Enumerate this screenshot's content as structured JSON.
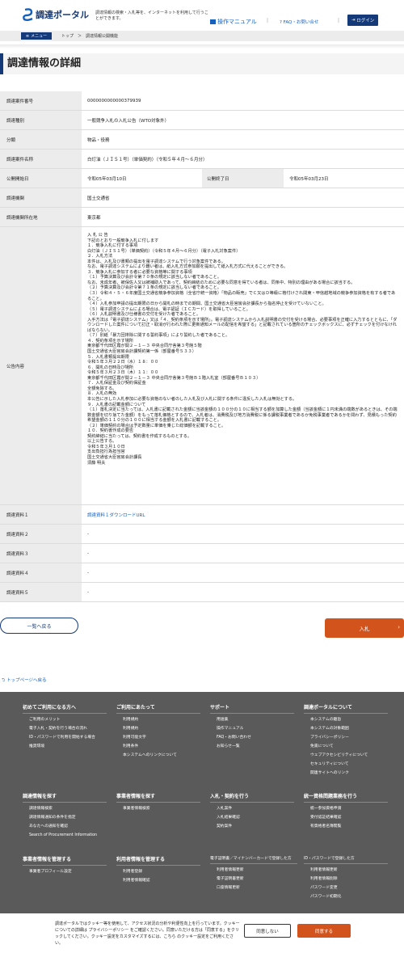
{
  "header": {
    "logo_text": "調達ポータル",
    "tagline": "調達情報の検索・入札等を、インターネットを利用して行うことができます。",
    "manual": "操作マニュアル",
    "faq": "FAQ・お問い合せ",
    "login": "ログイン"
  },
  "crumbbar": {
    "menu": "メニュー",
    "crumbs": "トップ　＞　調達情報公開機能"
  },
  "page_title": "調達情報の詳細",
  "detail": {
    "case_no_label": "調達案件番号",
    "case_no": "0000000000000379939",
    "type_label": "調達種別",
    "type": "一般競争入札の入札公告（WTO対象外）",
    "category_label": "分類",
    "category": "物品・役務",
    "name_label": "調達案件名称",
    "name": "白灯油（ＪＩＳ１号）（単価契約）（令和５年４月～６月分）",
    "start_label": "公開開始日",
    "start": "令和05年03月10日",
    "end_label": "公開終了日",
    "end": "令和05年03月23日",
    "org_label": "調達機関",
    "org": "国土交通省",
    "loc_label": "調達機関所在地",
    "loc": "東京都",
    "notice_label": "公告内容",
    "notice": "入 札 公 告\n下記のとおり一般競争入札に付します\n１．競争入札に付する事項\n白灯油（ＪＩＳ１号）（単価契約）（令和５年４月～６月分）（電子入札対象案件）\n２．入札方法\n本件は、入札及び書類の提出を電子調達システムで行う対象案件である。\nなお、電子調達システムにより難い者は、紙入札方式参加願を提出して紙入札方式に代えることができる。\n３．競争入札に参加する者に必要な資格等に関する事項\n（１）予算決算及び会計令第７０条の規定に該当しない者であること。\nなお、未成年者、被保佐人又は被補助人であって、契約締結のために必要な同意を得ている者は、同条中、特別の理由がある場合に該当する。\n（２）予算決算及び会計令第７１条の規定に該当しない者であること。\n（３）令和４・５・６年度国土交通省競争参加資格（全省庁統一資格）「物品の販売」でＣ又はＤ等級に格付けされ関東・甲信越地域の競争参加資格を有する者であること。\n（４）入札参加申請の提出期限の日から開札の時までの期間、国土交通省大臣官房会計課長から指名停止を受けていないこと。\n（５）電子調達システムによる場合は、電子認証（ＩＣカード）を取得していること。\n（６）入札説明書及び仕様書の交付を受けた者であること。\n入手方法は「電子調達システム」又は「４．契約条項を示す場所」。電子調達システムから入札説明書の交付を受ける場合、必要事項を正確に入力するとともに、「ダウンロードした案件について訂正・取消が行われた際に更新通知メールの配信を希望する」と記載されている箇所のチェックボックスに、必ずチェックを付けなければならない。\n（７）別紙「暴力団排除に関する誓約事項」により誓約した者であること。\n４．契約条項を示す場所\n東京都千代田区霞が関２－１－３ 中央合同庁舎第３号館５階\n国土交通省大臣官房会計課契約第一係（部屋番号５３３）\n５．入札書類提出期限\n令和５年３月２２日（水）１８：００\n６．開札の日時及び場所\n令和５年３月２３日（木）１１：００\n東京都千代田区霞が関２－１－３ 中央合同庁舎第３号館Ｂ１階入札室（部屋番号Ｂ１０３）\n７．入札保証金及び契約保証金\n全額免除する。\n８．入札の無効\n本公告に示した入札参加に必要な資格のない者のした入札及び入札に関する条件に違反した入札は無効とする。\n９．入札書の記載金額について\n（１）落札決定に当たっては、入札書に記載された金額に当該金額の１００分の１０に相当する額を加算した金額（当該金額に１円未満の端数があるときは、その端数金額を切り捨てた金額）をもって落札価格とするので、入札者は、消費税及び地方消費税に係る課税事業者であるか免税事業者であるかを問わず、見積もった契約希望金額の１１０分の１００に相当する金額を入札書に記載すること。\n（２）単価契約の場合は予定数量に単価を乗じた総価額を記載すること。\n１０．契約書作成の要否\n契約締結に当たっては、契約書を作成するものとする。\n以上公告する。\n令和５年３月１０日\n支出負担行為担当官\n国土交通省大臣官房会計課長\n須藤 明夫",
    "doc1_label": "調達資料１",
    "doc1": "調達資料１ダウンロードURL",
    "doc2_label": "調達資料２",
    "doc2": "-",
    "doc3_label": "調達資料３",
    "doc3": "-",
    "doc4_label": "調達資料４",
    "doc4": "-",
    "doc5_label": "調達資料５",
    "doc5": "-"
  },
  "buttons": {
    "back": "一覧へ戻る",
    "bid": "入札",
    "back_to_top": "トップページへ戻る"
  },
  "footer": {
    "col1": {
      "title": "初めてご利用になる方へ",
      "items": [
        "ご利用のメリット",
        "電子入札・契約を行う場合の流れ",
        "ID・パスワードで利用を開始する場合",
        "推奨環境"
      ]
    },
    "col2": {
      "title": "ご利用にあたって",
      "items": [
        "利用規約",
        "利用規約",
        "利用可能文字",
        "利用条件",
        "本システムへのリンクについて"
      ]
    },
    "col3": {
      "title": "サポート",
      "items": [
        "用語集",
        "操作マニュアル",
        "FAQ・お問い合わせ",
        "お知らせ一覧"
      ]
    },
    "col4": {
      "title": "調達ポータルについて",
      "items": [
        "本システムの趣旨",
        "本システムの対象範囲",
        "プライバシーポリシー",
        "免責について",
        "ウェブアクセシビリティについて",
        "セキュリティについて",
        "関連サイトへのリンク"
      ]
    },
    "col5": {
      "title": "調達情報を探す",
      "items": [
        "調達情報検索",
        "調達情報通知の条件を指定",
        "あなたへの通知を確認",
        "Search of Procurement Information"
      ]
    },
    "col6": {
      "title": "事業者情報を探す",
      "items": [
        "事業者情報検索"
      ]
    },
    "col7": {
      "title": "入札・契約を行う",
      "items": [
        "入札案件",
        "入札結果確認",
        "契約案件"
      ]
    },
    "col8": {
      "title": "統一資格問題業務を行う",
      "items": [
        "統一参加資格申請",
        "受付認証結果確認",
        "有資格者名簿閲覧"
      ]
    },
    "col9": {
      "title": "事業者情報を管理する",
      "items": [
        "事業者プロフィール設定"
      ]
    },
    "col10": {
      "title": "利用者情報を管理する",
      "items": [
        "利用者登録",
        "利用者情報確認"
      ]
    },
    "col11": {
      "title": "電子証明書／マイナンバーカードで登録した方",
      "items": [
        "利用者情報更新",
        "電子証明書更新",
        "口座情報更新"
      ]
    },
    "col12": {
      "title": "ID・パスワードで登録した方",
      "items": [
        "利用者情報更新",
        "利用者情報削除",
        "パスワード変更",
        "パスワード初期化"
      ]
    }
  },
  "cookie": {
    "text": "調達ポータルではクッキー等を使用して、アクセス状況の分析や利便性向上を行っています。クッキーについての詳細は プライバシーポリシー をご確認ください。同意いただける方は「同意する」をクリックしてください。クッキー設定をカスタマイズするには、こちら のクッキー設定をご利用ください。",
    "deny": "同意しない",
    "agree": "同意する"
  }
}
